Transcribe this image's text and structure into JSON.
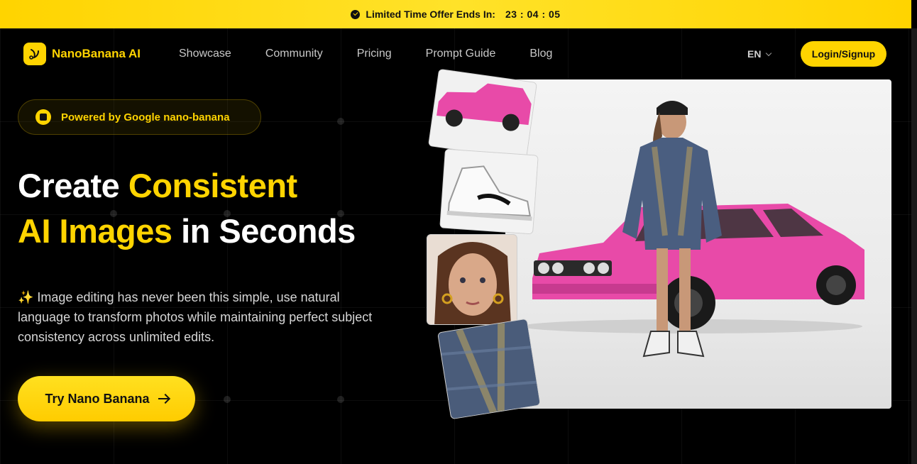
{
  "promo": {
    "icon": "clock-check-icon",
    "label": "Limited Time Offer Ends In:",
    "countdown": "23 : 04 : 05"
  },
  "nav": {
    "logo_icon": "banana-logo-icon",
    "brand": "NanoBanana AI",
    "links": [
      "Showcase",
      "Community",
      "Pricing",
      "Prompt Guide",
      "Blog"
    ],
    "language": "EN",
    "login": "Login/Signup"
  },
  "hero": {
    "badge": "Powered by Google nano-banana",
    "headline_part1": "Create ",
    "headline_highlight1": "Consistent",
    "headline_highlight2": "AI Images",
    "headline_part2": " in Seconds",
    "subtitle": "✨ Image editing has never been this simple, use natural language to transform photos while maintaining perfect subject consistency across unlimited edits.",
    "cta": "Try Nano Banana"
  },
  "colors": {
    "accent": "#ffd400",
    "background": "#000000",
    "car_pink": "#e84aa8"
  }
}
